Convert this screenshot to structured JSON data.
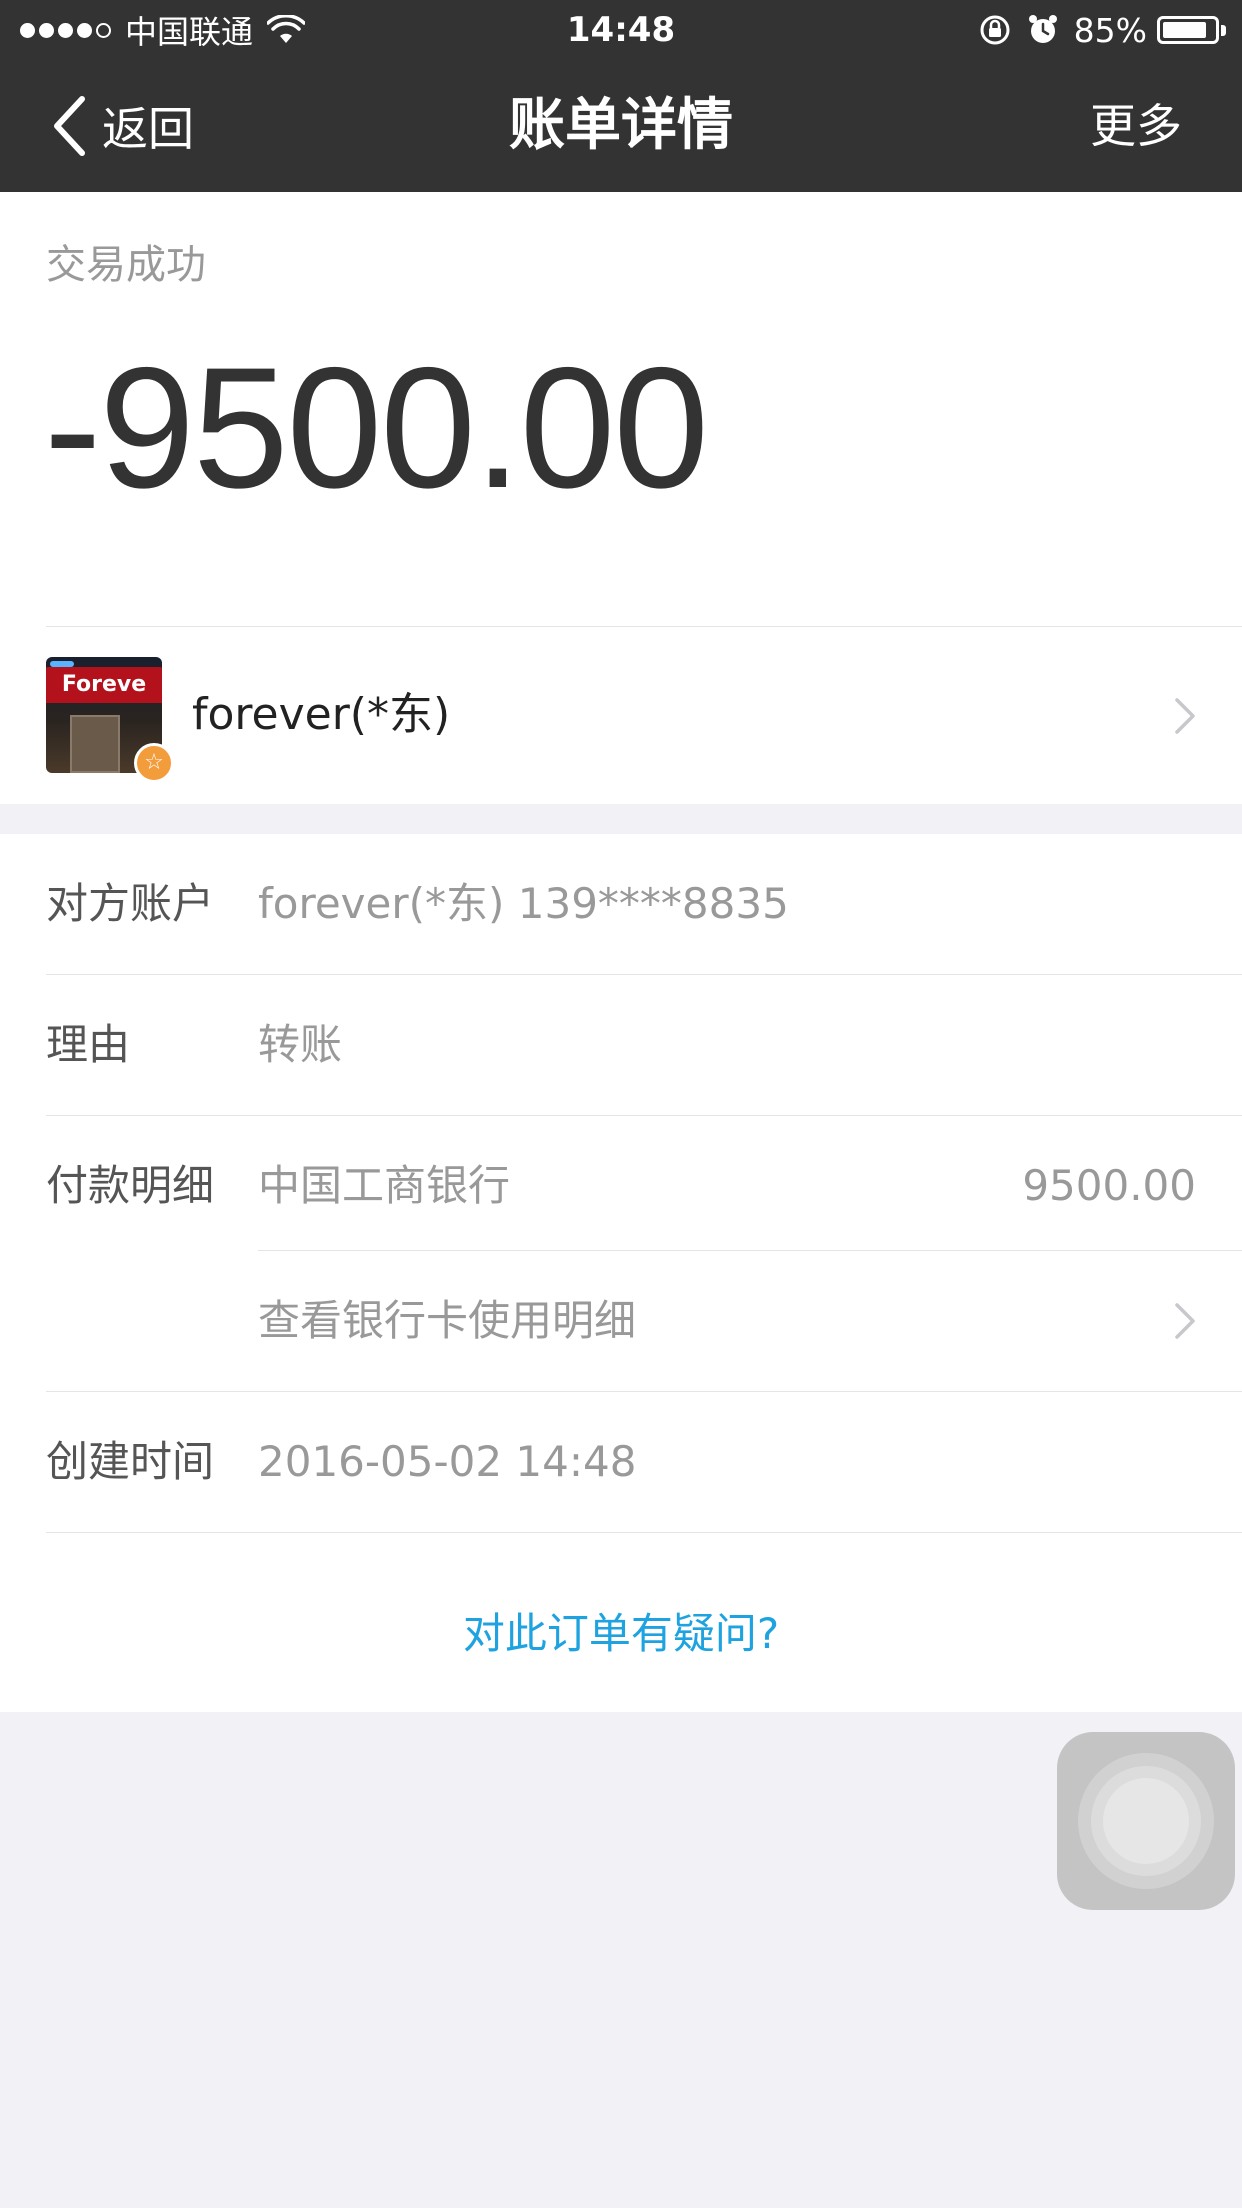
{
  "status_bar": {
    "carrier": "中国联通",
    "time": "14:48",
    "battery_percent": "85%",
    "signal_bars_filled": 4,
    "signal_bars_total": 5,
    "battery_level": 0.85
  },
  "nav": {
    "back_label": "返回",
    "title": "账单详情",
    "more_label": "更多"
  },
  "summary": {
    "status": "交易成功",
    "amount": "-9500.00",
    "merchant_name": "forever(*东)",
    "avatar_sign_text": "Foreve"
  },
  "details": {
    "account": {
      "label": "对方账户",
      "value": "forever(*东) 139****8835"
    },
    "reason": {
      "label": "理由",
      "value": "转账"
    },
    "payment": {
      "label": "付款明细",
      "bank": "中国工商银行",
      "amount": "9500.00",
      "bank_detail_link": "查看银行卡使用明细"
    },
    "created": {
      "label": "创建时间",
      "value": "2016-05-02 14:48"
    },
    "help_link": "对此订单有疑问?"
  },
  "colors": {
    "bar_bg": "#333333",
    "link": "#1fa3e0",
    "badge": "#f39c3c",
    "page_bg": "#f2f2f6"
  }
}
